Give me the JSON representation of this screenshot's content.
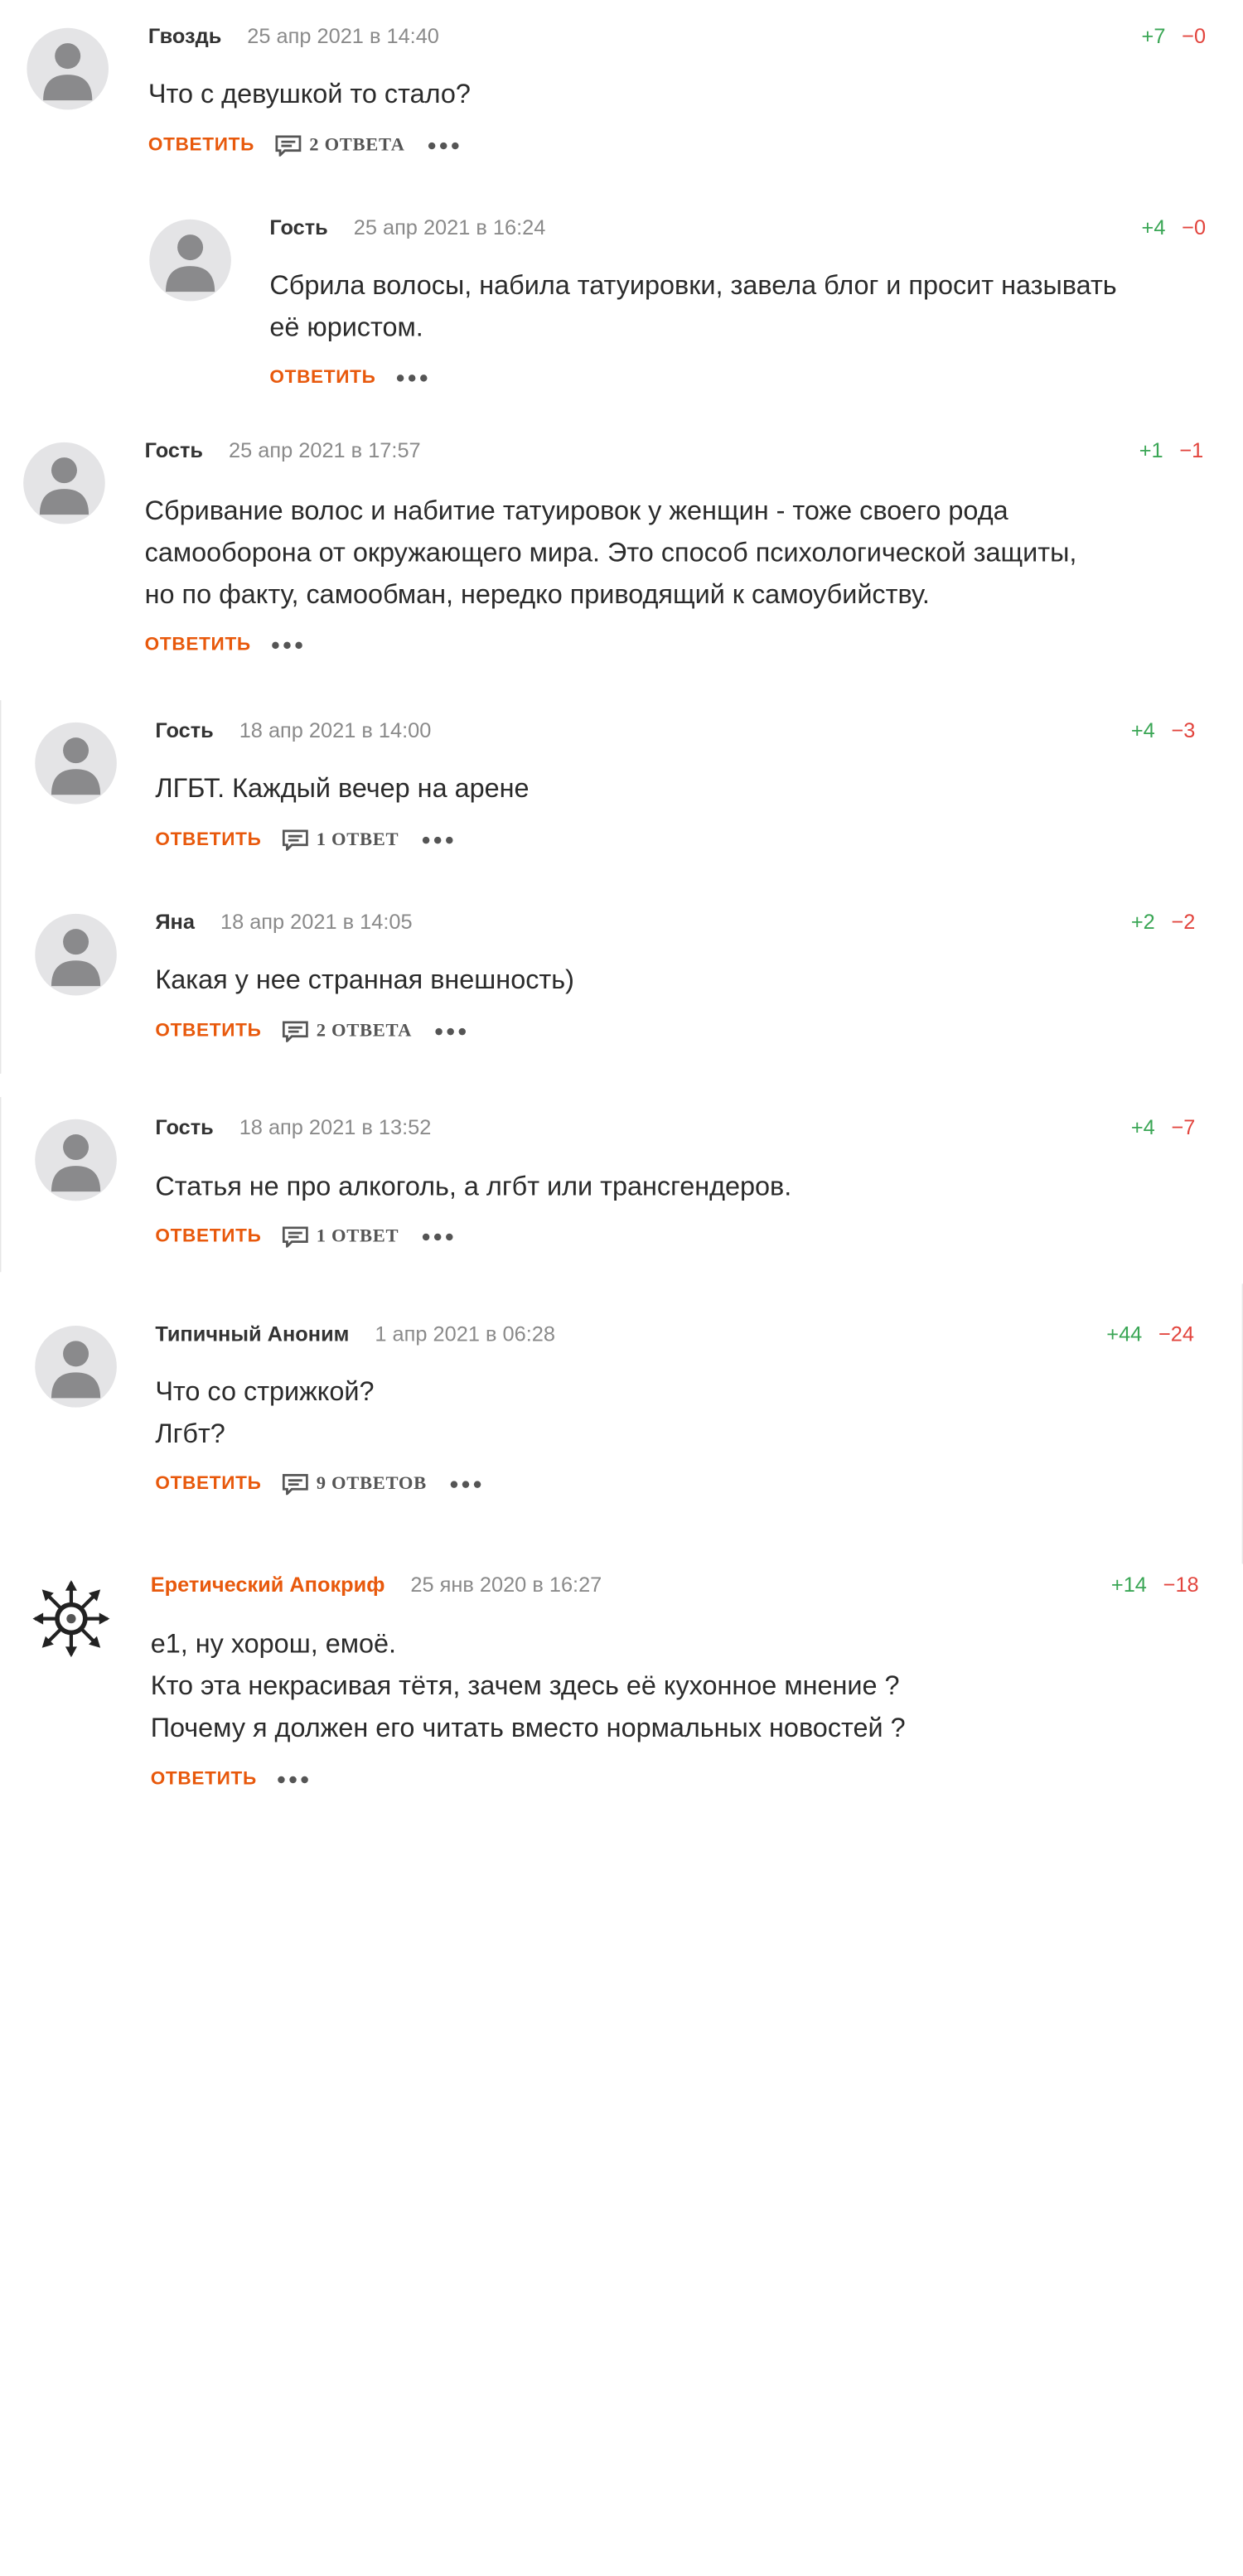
{
  "reply_label": "ОТВЕТИТЬ",
  "comments": [
    {
      "author": "Гвоздь",
      "date": "25 апр 2021 в 14:40",
      "plus": "+7",
      "minus": "−0",
      "text": [
        "Что с девушкой то стало?"
      ],
      "answers": "2 ОТВЕТА",
      "avatar": "default"
    },
    {
      "author": "Гость",
      "date": "25 апр 2021 в 16:24",
      "plus": "+4",
      "minus": "−0",
      "text": [
        "Сбрила волосы, набила татуировки, завела блог и просит называть",
        "её юристом."
      ],
      "answers": "",
      "avatar": "default"
    },
    {
      "author": "Гость",
      "date": "25 апр 2021 в 17:57",
      "plus": "+1",
      "minus": "−1",
      "text": [
        "Сбривание волос и набитие татуировок у женщин - тоже своего рода",
        "самооборона от окружающего мира. Это способ психологической защиты,",
        "но по факту, самообман, нередко приводящий к самоубийству."
      ],
      "answers": "",
      "avatar": "default"
    },
    {
      "author": "Гость",
      "date": "18 апр 2021 в 14:00",
      "plus": "+4",
      "minus": "−3",
      "text": [
        "ЛГБТ. Каждый вечер на арене"
      ],
      "answers": "1 ОТВЕТ",
      "avatar": "default"
    },
    {
      "author": "Яна",
      "date": "18 апр 2021 в 14:05",
      "plus": "+2",
      "minus": "−2",
      "text": [
        "Какая у нее странная внешность)"
      ],
      "answers": "2 ОТВЕТА",
      "avatar": "default"
    },
    {
      "author": "Гость",
      "date": "18 апр 2021 в 13:52",
      "plus": "+4",
      "minus": "−7",
      "text": [
        "Статья не про алкоголь, а лгбт или трансгендеров."
      ],
      "answers": "1 ОТВЕТ",
      "avatar": "default"
    },
    {
      "author": "Типичный Аноним",
      "date": "1 апр 2021 в 06:28",
      "plus": "+44",
      "minus": "−24",
      "text": [
        "Что со стрижкой?",
        "Лгбт?"
      ],
      "answers": "9 ОТВЕТОВ",
      "avatar": "default"
    },
    {
      "author": "Еретический Апокриф",
      "date": "25 янв 2020 в 16:27",
      "plus": "+14",
      "minus": "−18",
      "text": [
        "е1, ну хорош, емоё.",
        "Кто эта некрасивая тётя, зачем здесь её кухонное мнение ?",
        "Почему я должен его читать вместо нормальных новостей ?"
      ],
      "answers": "",
      "avatar": "chaos-star"
    }
  ],
  "colors": {
    "accent": "#e8590c",
    "plus": "#3aa655",
    "minus": "#e2443d",
    "avatar_bg": "#e4e4e6",
    "avatar_fg": "#8a8a8c"
  }
}
